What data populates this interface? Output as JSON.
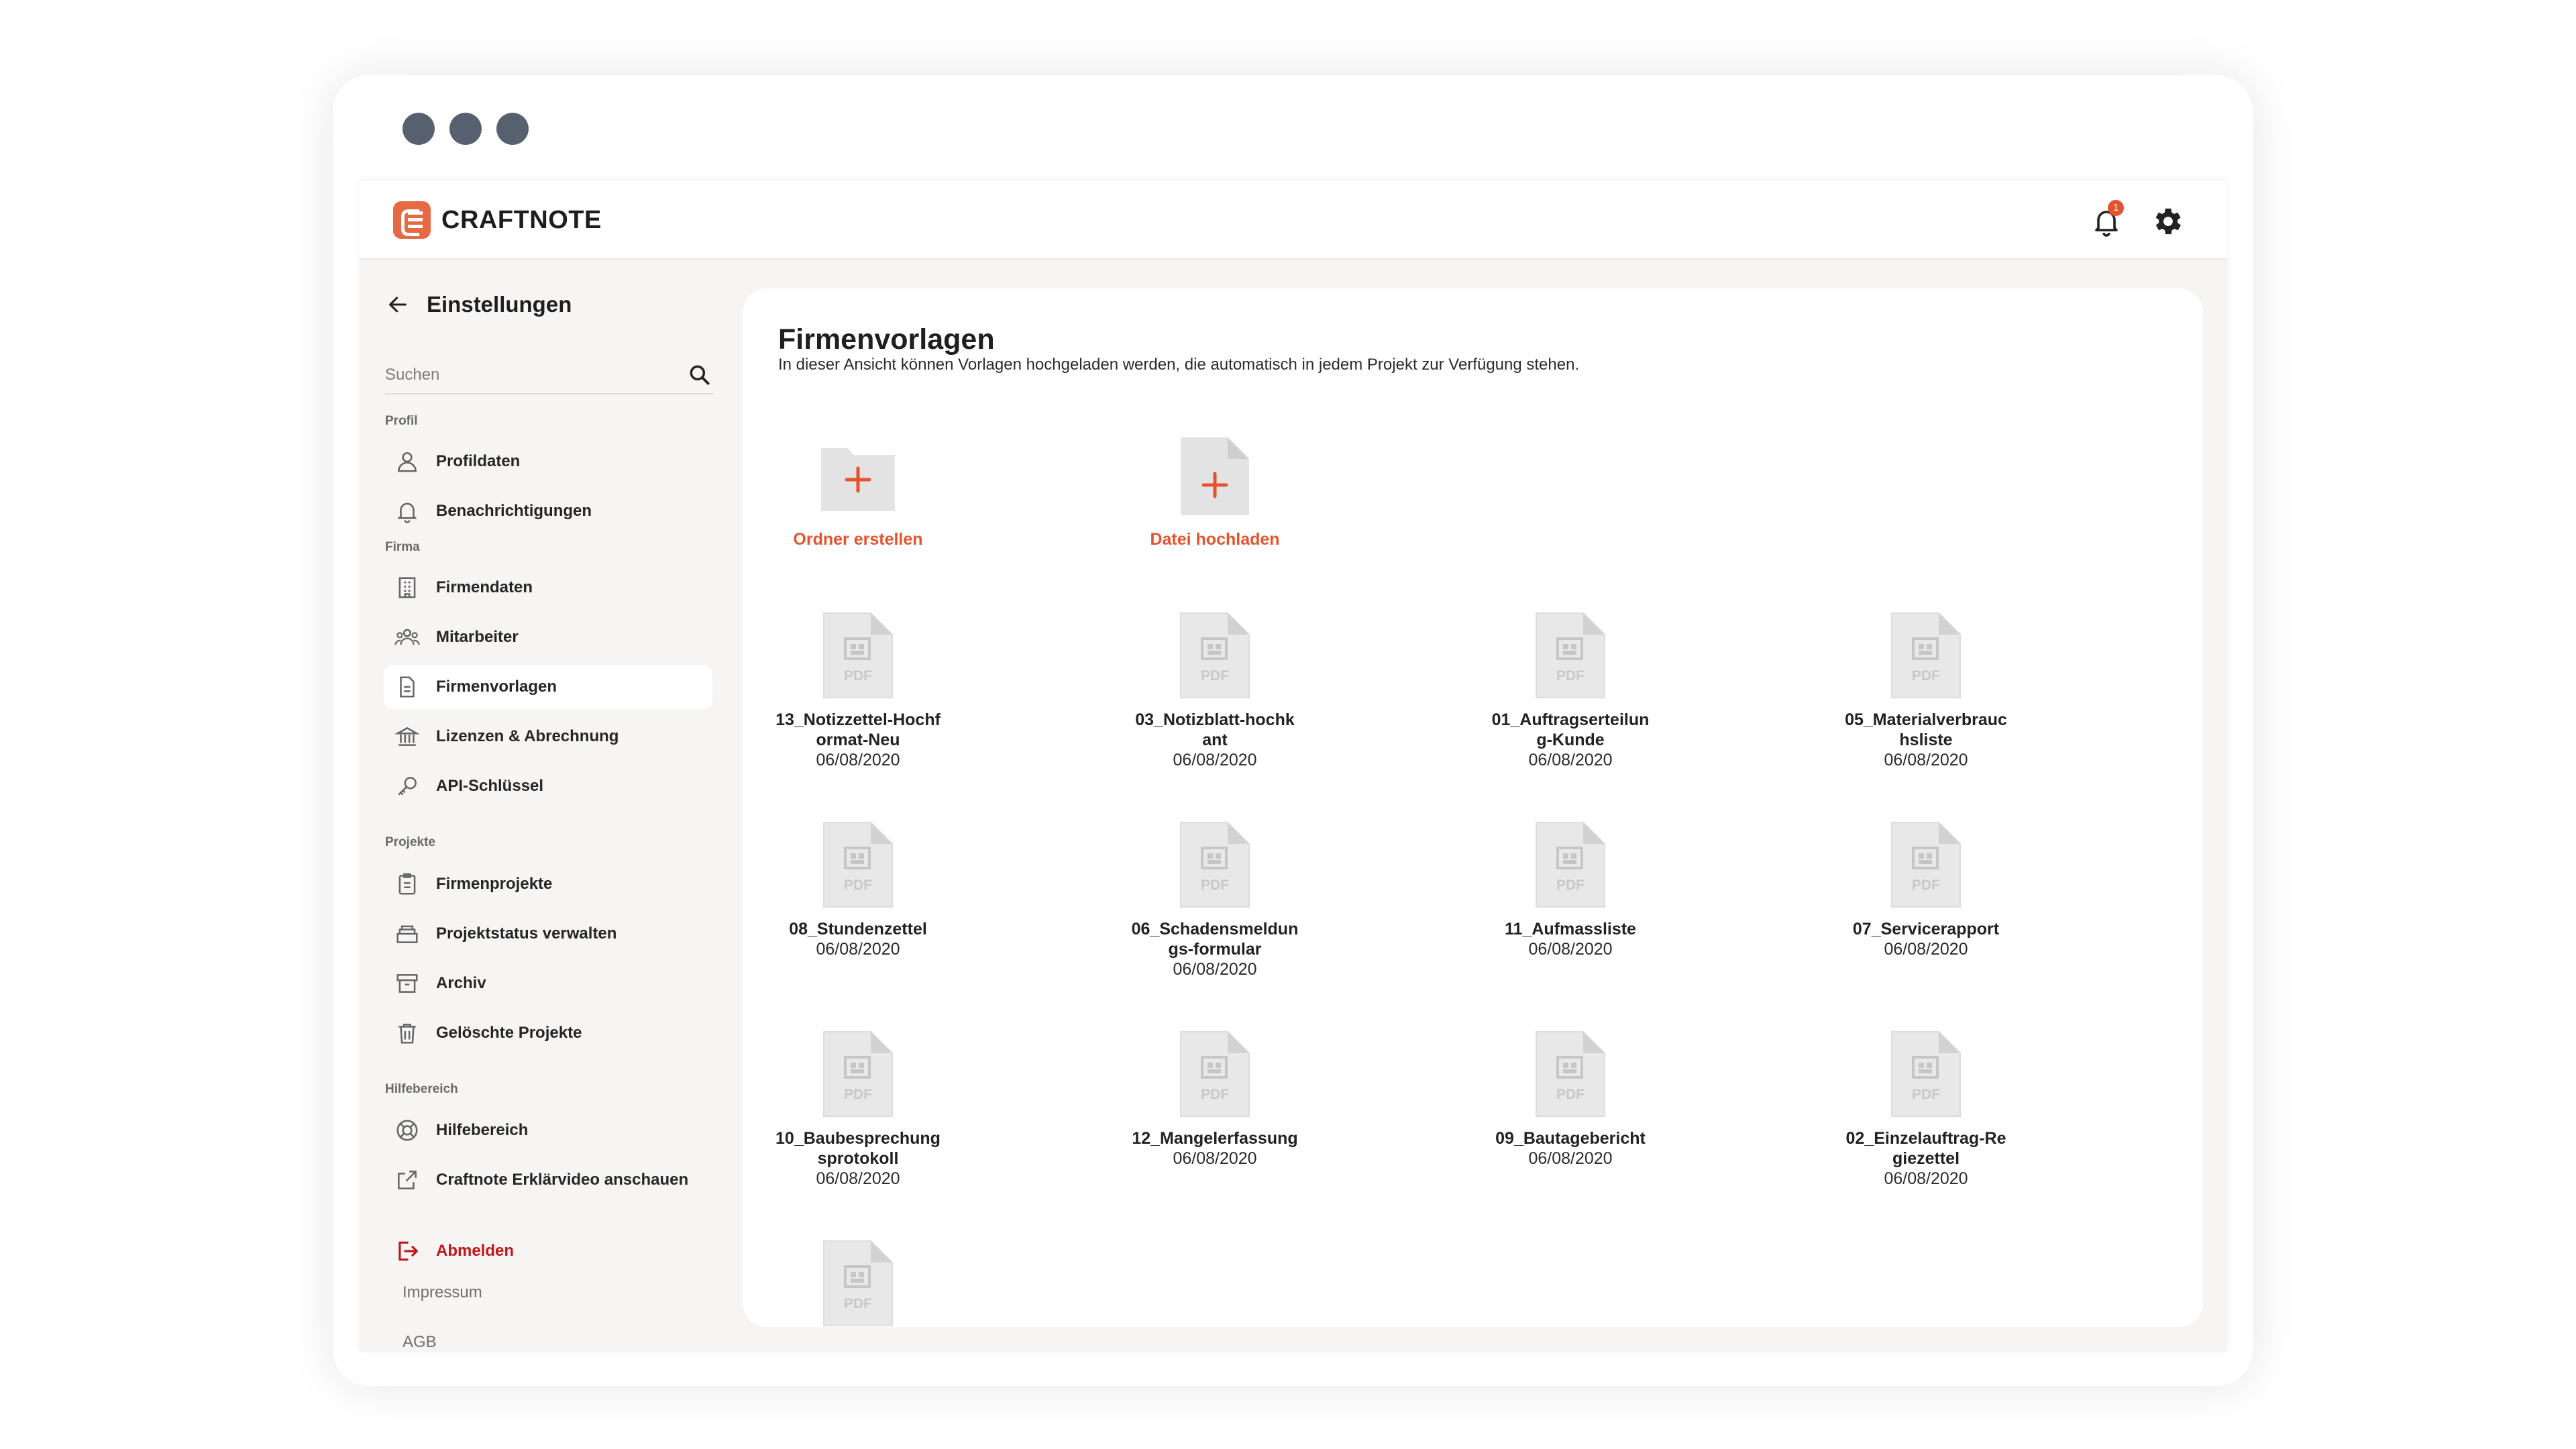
{
  "app": {
    "brand": "CRAFTNOTE",
    "notification_count": "1",
    "accent_color": "#e5532e",
    "logo_color": "#e56a43"
  },
  "sidebar": {
    "back_title": "Einstellungen",
    "search_placeholder": "Suchen",
    "sections": {
      "profil": "Profil",
      "firma": "Firma",
      "projekte": "Projekte",
      "hilfe": "Hilfebereich"
    },
    "items": {
      "profildaten": "Profildaten",
      "benachrichtigungen": "Benachrichtigungen",
      "firmendaten": "Firmendaten",
      "mitarbeiter": "Mitarbeiter",
      "firmenvorlagen": "Firmenvorlagen",
      "lizenzen": "Lizenzen & Abrechnung",
      "api": "API-Schlüssel",
      "firmenprojekte": "Firmenprojekte",
      "projektstatus": "Projektstatus verwalten",
      "archiv": "Archiv",
      "geloeschte": "Gelöschte Projekte",
      "hilfebereich": "Hilfebereich",
      "video": "Craftnote Erklärvideo anschauen"
    },
    "logout": "Abmelden",
    "impressum": "Impressum",
    "agb": "AGB"
  },
  "main": {
    "title": "Firmenvorlagen",
    "subtitle": "In dieser Ansicht können Vorlagen hochgeladen werden, die automatisch in jedem Projekt zur Verfügung stehen.",
    "create_folder": "Ordner erstellen",
    "upload_file": "Datei hochladen",
    "file_badge": "PDF",
    "files": [
      {
        "name": "13_Notizzettel-Hochformat-Neu",
        "date": "06/08/2020"
      },
      {
        "name": "03_Notizblatt-hochkant",
        "date": "06/08/2020"
      },
      {
        "name": "01_Auftragserteilung-Kunde",
        "date": "06/08/2020"
      },
      {
        "name": "05_Materialverbrauchsliste",
        "date": "06/08/2020"
      },
      {
        "name": "08_Stundenzettel",
        "date": "06/08/2020"
      },
      {
        "name": "06_Schadensmeldungs-formular",
        "date": "06/08/2020"
      },
      {
        "name": "11_Aufmassliste",
        "date": "06/08/2020"
      },
      {
        "name": "07_Servicerapport",
        "date": "06/08/2020"
      },
      {
        "name": "10_Baubesprechungsprotokoll",
        "date": "06/08/2020"
      },
      {
        "name": "12_Mangelerfassung",
        "date": "06/08/2020"
      },
      {
        "name": "09_Bautagebericht",
        "date": "06/08/2020"
      },
      {
        "name": "02_Einzelauftrag-Regiezettel",
        "date": "06/08/2020"
      },
      {
        "name": "",
        "date": ""
      }
    ]
  }
}
